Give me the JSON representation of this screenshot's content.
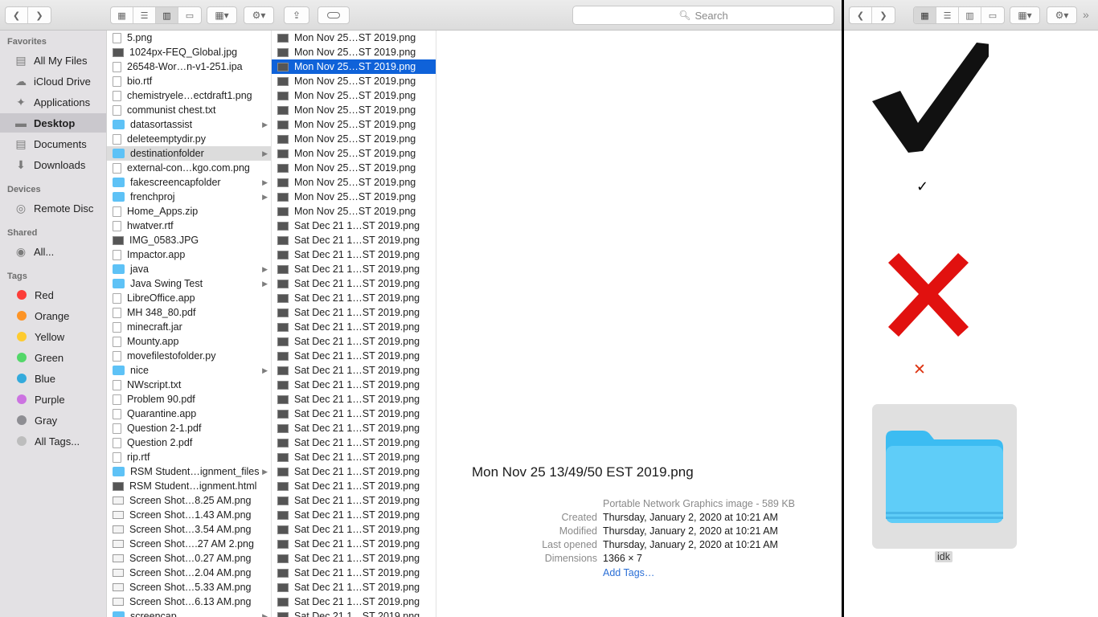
{
  "left_window": {
    "toolbar": {
      "back_icon": "chevron-left",
      "forward_icon": "chevron-right",
      "view_modes": [
        "icons",
        "list",
        "columns",
        "gallery"
      ],
      "active_view": "columns",
      "group_icon": "grid-dropdown",
      "action_icon": "gear-dropdown",
      "share_icon": "share",
      "tag_icon": "tag",
      "search_placeholder": "Search"
    },
    "sidebar": {
      "favorites_title": "Favorites",
      "favorites": [
        {
          "label": "All My Files",
          "icon": "all-files"
        },
        {
          "label": "iCloud Drive",
          "icon": "cloud"
        },
        {
          "label": "Applications",
          "icon": "applications"
        },
        {
          "label": "Desktop",
          "icon": "desktop",
          "selected": true
        },
        {
          "label": "Documents",
          "icon": "documents"
        },
        {
          "label": "Downloads",
          "icon": "downloads"
        }
      ],
      "devices_title": "Devices",
      "devices": [
        {
          "label": "Remote Disc",
          "icon": "disc"
        }
      ],
      "shared_title": "Shared",
      "shared": [
        {
          "label": "All...",
          "icon": "network"
        }
      ],
      "tags_title": "Tags",
      "tags": [
        {
          "label": "Red",
          "color": "#fc3d39"
        },
        {
          "label": "Orange",
          "color": "#fd9426"
        },
        {
          "label": "Yellow",
          "color": "#fecb2f"
        },
        {
          "label": "Green",
          "color": "#53d769"
        },
        {
          "label": "Blue",
          "color": "#34aadc"
        },
        {
          "label": "Purple",
          "color": "#cc73e1"
        },
        {
          "label": "Gray",
          "color": "#8e8e93"
        },
        {
          "label": "All Tags...",
          "color": "#bdbdbd"
        }
      ]
    },
    "column1": [
      {
        "name": "5.png",
        "kind": "doc"
      },
      {
        "name": "1024px-FEQ_Global.jpg",
        "kind": "img"
      },
      {
        "name": "26548-Wor…n-v1-251.ipa",
        "kind": "doc"
      },
      {
        "name": "bio.rtf",
        "kind": "doc"
      },
      {
        "name": "chemistryele…ectdraft1.png",
        "kind": "doc"
      },
      {
        "name": "communist chest.txt",
        "kind": "doc"
      },
      {
        "name": "datasortassist",
        "kind": "folder",
        "arrow": true
      },
      {
        "name": "deleteemptydir.py",
        "kind": "doc"
      },
      {
        "name": "destinationfolder",
        "kind": "folder",
        "arrow": true,
        "path": true
      },
      {
        "name": "external-con…kgo.com.png",
        "kind": "doc"
      },
      {
        "name": "fakescreencapfolder",
        "kind": "folder",
        "arrow": true
      },
      {
        "name": "frenchproj",
        "kind": "folder",
        "arrow": true
      },
      {
        "name": "Home_Apps.zip",
        "kind": "doc"
      },
      {
        "name": "hwatver.rtf",
        "kind": "doc"
      },
      {
        "name": "IMG_0583.JPG",
        "kind": "img"
      },
      {
        "name": "Impactor.app",
        "kind": "doc"
      },
      {
        "name": "java",
        "kind": "folder",
        "arrow": true
      },
      {
        "name": "Java Swing Test",
        "kind": "folder",
        "arrow": true
      },
      {
        "name": "LibreOffice.app",
        "kind": "doc"
      },
      {
        "name": "MH 348_80.pdf",
        "kind": "doc"
      },
      {
        "name": "minecraft.jar",
        "kind": "doc"
      },
      {
        "name": "Mounty.app",
        "kind": "doc"
      },
      {
        "name": "movefilestofolder.py",
        "kind": "doc"
      },
      {
        "name": "nice",
        "kind": "folder",
        "arrow": true
      },
      {
        "name": "NWscript.txt",
        "kind": "doc"
      },
      {
        "name": "Problem 90.pdf",
        "kind": "doc"
      },
      {
        "name": "Quarantine.app",
        "kind": "doc"
      },
      {
        "name": "Question 2-1.pdf",
        "kind": "doc"
      },
      {
        "name": "Question 2.pdf",
        "kind": "doc"
      },
      {
        "name": "rip.rtf",
        "kind": "doc"
      },
      {
        "name": "RSM Student…ignment_files",
        "kind": "folder",
        "arrow": true
      },
      {
        "name": "RSM Student…ignment.html",
        "kind": "img"
      },
      {
        "name": "Screen Shot…8.25 AM.png",
        "kind": "shot"
      },
      {
        "name": "Screen Shot…1.43 AM.png",
        "kind": "shot"
      },
      {
        "name": "Screen Shot…3.54 AM.png",
        "kind": "shot"
      },
      {
        "name": "Screen Shot….27 AM 2.png",
        "kind": "shot"
      },
      {
        "name": "Screen Shot…0.27 AM.png",
        "kind": "shot"
      },
      {
        "name": "Screen Shot…2.04 AM.png",
        "kind": "shot"
      },
      {
        "name": "Screen Shot…5.33 AM.png",
        "kind": "shot"
      },
      {
        "name": "Screen Shot…6.13 AM.png",
        "kind": "shot"
      },
      {
        "name": "screencap",
        "kind": "folder",
        "arrow": true
      }
    ],
    "column2": [
      {
        "name": "Mon Nov 25…ST 2019.png"
      },
      {
        "name": "Mon Nov 25…ST 2019.png"
      },
      {
        "name": "Mon Nov 25…ST 2019.png",
        "selected": true
      },
      {
        "name": "Mon Nov 25…ST 2019.png"
      },
      {
        "name": "Mon Nov 25…ST 2019.png"
      },
      {
        "name": "Mon Nov 25…ST 2019.png"
      },
      {
        "name": "Mon Nov 25…ST 2019.png"
      },
      {
        "name": "Mon Nov 25…ST 2019.png"
      },
      {
        "name": "Mon Nov 25…ST 2019.png"
      },
      {
        "name": "Mon Nov 25…ST 2019.png"
      },
      {
        "name": "Mon Nov 25…ST 2019.png"
      },
      {
        "name": "Mon Nov 25…ST 2019.png"
      },
      {
        "name": "Mon Nov 25…ST 2019.png"
      },
      {
        "name": "Sat Dec 21 1…ST 2019.png"
      },
      {
        "name": "Sat Dec 21 1…ST 2019.png"
      },
      {
        "name": "Sat Dec 21 1…ST 2019.png"
      },
      {
        "name": "Sat Dec 21 1…ST 2019.png"
      },
      {
        "name": "Sat Dec 21 1…ST 2019.png"
      },
      {
        "name": "Sat Dec 21 1…ST 2019.png"
      },
      {
        "name": "Sat Dec 21 1…ST 2019.png"
      },
      {
        "name": "Sat Dec 21 1…ST 2019.png"
      },
      {
        "name": "Sat Dec 21 1…ST 2019.png"
      },
      {
        "name": "Sat Dec 21 1…ST 2019.png"
      },
      {
        "name": "Sat Dec 21 1…ST 2019.png"
      },
      {
        "name": "Sat Dec 21 1…ST 2019.png"
      },
      {
        "name": "Sat Dec 21 1…ST 2019.png"
      },
      {
        "name": "Sat Dec 21 1…ST 2019.png"
      },
      {
        "name": "Sat Dec 21 1…ST 2019.png"
      },
      {
        "name": "Sat Dec 21 1…ST 2019.png"
      },
      {
        "name": "Sat Dec 21 1…ST 2019.png"
      },
      {
        "name": "Sat Dec 21 1…ST 2019.png"
      },
      {
        "name": "Sat Dec 21 1…ST 2019.png"
      },
      {
        "name": "Sat Dec 21 1…ST 2019.png"
      },
      {
        "name": "Sat Dec 21 1…ST 2019.png"
      },
      {
        "name": "Sat Dec 21 1…ST 2019.png"
      },
      {
        "name": "Sat Dec 21 1…ST 2019.png"
      },
      {
        "name": "Sat Dec 21 1…ST 2019.png"
      },
      {
        "name": "Sat Dec 21 1…ST 2019.png"
      },
      {
        "name": "Sat Dec 21 1…ST 2019.png"
      },
      {
        "name": "Sat Dec 21 1…ST 2019.png"
      },
      {
        "name": "Sat Dec 21 1…ST 2019.png"
      }
    ],
    "preview": {
      "file_name": "Mon Nov 25 13/49/50 EST 2019.png",
      "kind_size": "Portable Network Graphics image - 589 KB",
      "created_label": "Created",
      "created_value": "Thursday, January 2, 2020 at 10:21 AM",
      "modified_label": "Modified",
      "modified_value": "Thursday, January 2, 2020 at 10:21 AM",
      "opened_label": "Last opened",
      "opened_value": "Thursday, January 2, 2020 at 10:21 AM",
      "dimensions_label": "Dimensions",
      "dimensions_value": "1366 × 7",
      "add_tags": "Add Tags…"
    }
  },
  "right_window": {
    "toolbar": {
      "back_icon": "chevron-left",
      "forward_icon": "chevron-right",
      "view_modes": [
        "icons",
        "list",
        "columns",
        "gallery"
      ],
      "active_view": "icons",
      "more_icon": "chevron-double-right"
    },
    "items": [
      {
        "kind": "checkmark-image"
      },
      {
        "kind": "x-mark-image"
      },
      {
        "kind": "folder",
        "label": "idk",
        "selected": true
      }
    ]
  }
}
